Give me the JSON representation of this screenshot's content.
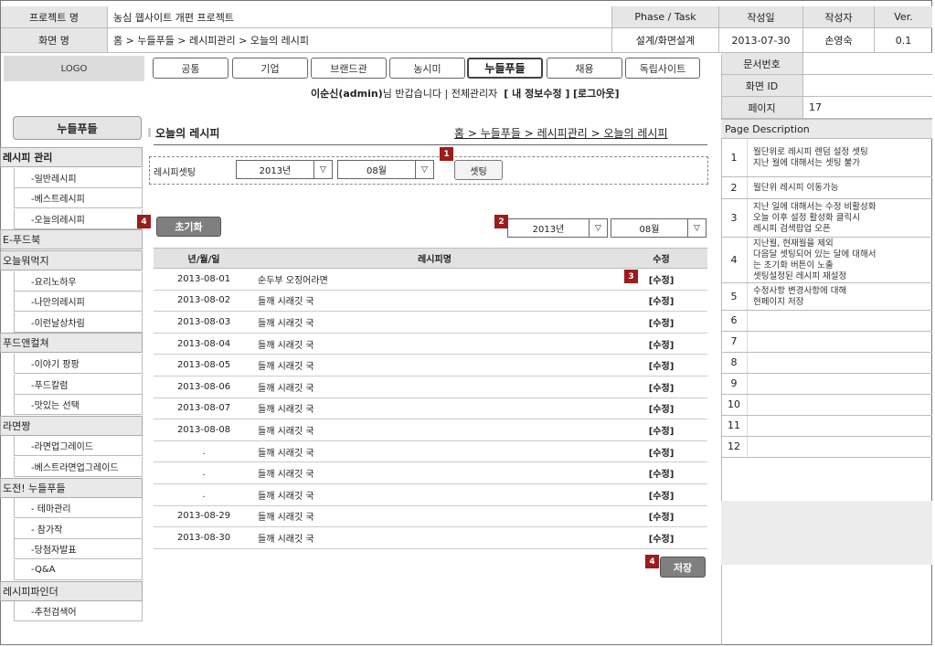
{
  "header": {
    "project_label": "프로젝트 명",
    "project_value": "농심 웹사이트 개편 프로젝트",
    "phase_label": "Phase / Task",
    "date_label": "작성일",
    "author_label": "작성자",
    "ver_label": "Ver.",
    "screen_label": "화면 명",
    "screen_value": "홈 > 누들푸들 > 레시피관리 > 오늘의 레시피",
    "phase_value": "설계/화면설계",
    "date_value": "2013-07-30",
    "author_value": "손영숙",
    "ver_value": "0.1",
    "docno_label": "문서번호",
    "docno_value": "",
    "screenid_label": "화면 ID",
    "screenid_value": "",
    "page_label": "페이지",
    "page_value": "17"
  },
  "logo": "LOGO",
  "nav": [
    "공통",
    "기업",
    "브랜드관",
    "농시미",
    "누들푸들",
    "채용",
    "독립사이트"
  ],
  "user": {
    "name": "이순신(admin)",
    "greeting": "님 반갑습니다 | 전체관리자",
    "edit": "[ 내 정보수정 ]",
    "logout": "[로그아웃]"
  },
  "sidebar": {
    "title": "누들푸들",
    "items": [
      {
        "label": "레시피 관리",
        "type": "cat-bold"
      },
      {
        "label": "-일반레시피",
        "type": "sub"
      },
      {
        "label": "-베스트레시피",
        "type": "sub"
      },
      {
        "label": "-오늘의레시피",
        "type": "sub"
      },
      {
        "label": "E-푸드북",
        "type": "cat"
      },
      {
        "label": "오늘뭐먹지",
        "type": "cat"
      },
      {
        "label": "-요리노하우",
        "type": "sub"
      },
      {
        "label": "-나만의레시피",
        "type": "sub"
      },
      {
        "label": "-이런날상차림",
        "type": "sub"
      },
      {
        "label": "푸드앤컬쳐",
        "type": "cat"
      },
      {
        "label": "-이야기 팡팡",
        "type": "sub"
      },
      {
        "label": "-푸드칼럼",
        "type": "sub"
      },
      {
        "label": "-맛있는 선택",
        "type": "sub"
      },
      {
        "label": "라면짱",
        "type": "cat"
      },
      {
        "label": "-라면업그레이드",
        "type": "sub"
      },
      {
        "label": "-베스트라면업그레이드",
        "type": "sub"
      },
      {
        "label": "도전! 누들푸들",
        "type": "cat"
      },
      {
        "label": "- 테마관리",
        "type": "sub"
      },
      {
        "label": "- 참가작",
        "type": "sub"
      },
      {
        "label": "-당첨자발표",
        "type": "sub"
      },
      {
        "label": "-Q&A",
        "type": "sub"
      },
      {
        "label": "레시피파인더",
        "type": "cat"
      },
      {
        "label": "-추천검색어",
        "type": "sub"
      }
    ]
  },
  "content": {
    "title": "오늘의 레시피",
    "breadcrumb": "홈 > 누들푸들 > 레시피관리 > 오늘의 레시피",
    "setting": {
      "label": "레시피셋팅",
      "year": "2013년",
      "month": "08월",
      "button": "셋팅"
    },
    "reset_button": "초기화",
    "filter_year": "2013년",
    "filter_month": "08월",
    "save_button": "저장",
    "badges": {
      "b1": "1",
      "b2": "2",
      "b3": "3",
      "b4a": "4",
      "b4b": "4"
    },
    "table": {
      "headers": [
        "년/월/일",
        "레시피명",
        "수정"
      ],
      "rows": [
        [
          "2013-08-01",
          "순두부 오징어라면",
          "[수정]"
        ],
        [
          "2013-08-02",
          "들깨 시래깃 국",
          "[수정]"
        ],
        [
          "2013-08-03",
          "들깨 시래깃 국",
          "[수정]"
        ],
        [
          "2013-08-04",
          "들깨 시래깃 국",
          "[수정]"
        ],
        [
          "2013-08-05",
          "들깨 시래깃 국",
          "[수정]"
        ],
        [
          "2013-08-06",
          "들깨 시래깃 국",
          "[수정]"
        ],
        [
          "2013-08-07",
          "들깨 시래깃 국",
          "[수정]"
        ],
        [
          "2013-08-08",
          "들깨 시래깃 국",
          "[수정]"
        ],
        [
          ".",
          "들깨 시래깃 국",
          "[수정]"
        ],
        [
          ".",
          "들깨 시래깃 국",
          "[수정]"
        ],
        [
          ".",
          "들깨 시래깃 국",
          "[수정]"
        ],
        [
          "2013-08-29",
          "들깨 시래깃 국",
          "[수정]"
        ],
        [
          "2013-08-30",
          "들깨 시래깃 국",
          "[수정]"
        ]
      ]
    }
  },
  "description": {
    "title": "Page Description",
    "items": [
      {
        "n": "1",
        "text": "월단위로 레시피 렌덤 설정 셋팅\n지난 월에 대해서는 셋팅 불가"
      },
      {
        "n": "2",
        "text": "월단위 레시피 이동가능"
      },
      {
        "n": "3",
        "text": "지난 일에 대해서는 수정 비활성화\n오늘 이후 설정 활성화 클릭시\n레시피 검색팝업 오픈"
      },
      {
        "n": "4",
        "text": "지난월, 현재월을 제외\n다음달 셋팅되어 있는 달에 대해서\n는 초기화 버튼이 노출\n셋팅설정된 레시피 재설정"
      },
      {
        "n": "5",
        "text": "수정사항 변경사항에 대해\n현페이지 저장"
      },
      {
        "n": "6",
        "text": ""
      },
      {
        "n": "7",
        "text": ""
      },
      {
        "n": "8",
        "text": ""
      },
      {
        "n": "9",
        "text": ""
      },
      {
        "n": "10",
        "text": ""
      },
      {
        "n": "11",
        "text": ""
      },
      {
        "n": "12",
        "text": ""
      }
    ]
  }
}
